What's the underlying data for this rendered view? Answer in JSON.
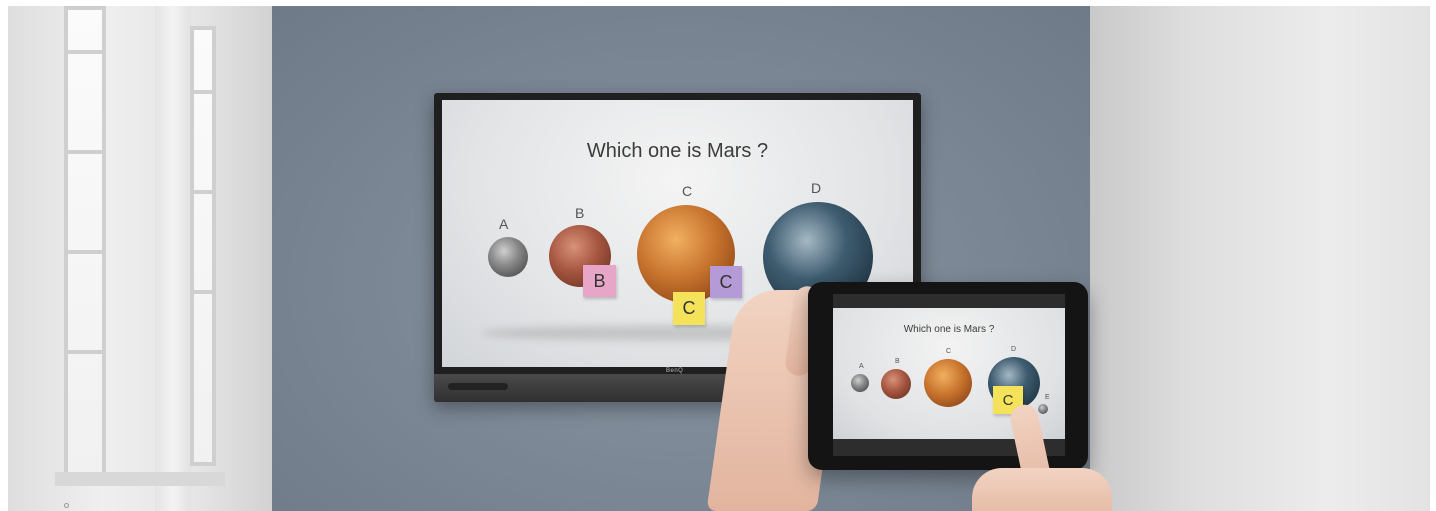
{
  "display": {
    "brand": "BenQ",
    "question": "Which one is Mars ?",
    "options": [
      {
        "label": "A",
        "planet": "mercury"
      },
      {
        "label": "B",
        "planet": "mars"
      },
      {
        "label": "C",
        "planet": "venus"
      },
      {
        "label": "D",
        "planet": "earth"
      }
    ],
    "notes": [
      {
        "text": "B",
        "color": "#e7a6c8"
      },
      {
        "text": "C",
        "color": "#f3e25a"
      },
      {
        "text": "C",
        "color": "#b49ad6"
      }
    ]
  },
  "tablet": {
    "question": "Which one is Mars ?",
    "options": [
      "A",
      "B",
      "C",
      "D",
      "E"
    ],
    "note": {
      "text": "C",
      "color": "#f3e25a"
    }
  }
}
